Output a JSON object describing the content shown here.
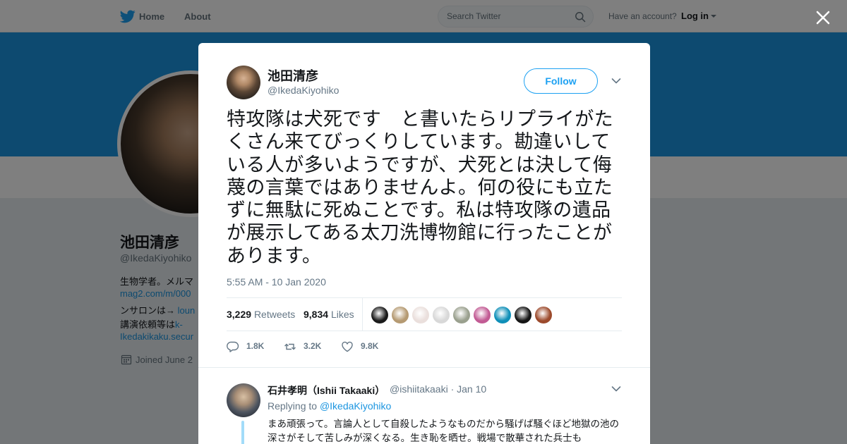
{
  "nav": {
    "home_label": "Home",
    "about_label": "About",
    "search_placeholder": "Search Twitter",
    "have_account": "Have an account?",
    "login_label": "Log in"
  },
  "profile": {
    "name": "池田清彦",
    "handle": "@IkedaKiyohiko",
    "bio_lines": [
      {
        "text": "生物学者。メルマ",
        "link": ""
      },
      {
        "text": "",
        "link": "mag2.com/m/000"
      },
      {
        "text": "ンサロンは→ ",
        "link": "loun"
      },
      {
        "text": "講演依頼等は",
        "link": "k-"
      },
      {
        "text": "",
        "link": "Ikedakikaku.secur"
      }
    ],
    "joined": "Joined June 2"
  },
  "tweet": {
    "author_name": "池田清彦",
    "author_handle": "@IkedaKiyohiko",
    "follow_label": "Follow",
    "text": "特攻隊は犬死です　と書いたらリプライがたくさん来てびっくりしています。勘違いしている人が多いようですが、犬死とは決して侮蔑の言葉ではありませんよ。何の役にも立たずに無駄に死ぬことです。私は特攻隊の遺品が展示してある太刀洗博物館に行ったことがあります。",
    "timestamp": "5:55 AM - 10 Jan 2020",
    "retweets_count": "3,229",
    "retweets_label": "Retweets",
    "likes_count": "9,834",
    "likes_label": "Likes",
    "likers": [
      {
        "name": "liker-1",
        "color": "#1a1a1a"
      },
      {
        "name": "liker-2",
        "color": "#b59a72"
      },
      {
        "name": "liker-3",
        "color": "#eadfdc"
      },
      {
        "name": "liker-4",
        "color": "#d8d8d8"
      },
      {
        "name": "liker-5",
        "color": "#9aa08e"
      },
      {
        "name": "liker-6",
        "color": "#c25b94"
      },
      {
        "name": "liker-7",
        "color": "#0f8fb8"
      },
      {
        "name": "liker-8",
        "color": "#151515"
      },
      {
        "name": "liker-9",
        "color": "#9c4a2c"
      }
    ],
    "reply_count": "1.8K",
    "retweet_count": "3.2K",
    "like_count": "9.8K"
  },
  "reply": {
    "name": "石井孝明（Ishii Takaaki）",
    "meta": "@ishiitakaaki · Jan 10",
    "replying_prefix": "Replying to ",
    "replying_to": "@IkedaKiyohiko",
    "text": "まあ頑張って。言論人として自殺したようなものだから騒げば騒ぐほど地獄の池の深さがそして苦しみが深くなる。生き恥を晒せ。戦場で散華された兵士も"
  },
  "colors": {
    "brand": "#1da1f2",
    "banner": "#1b95e0",
    "text_primary": "#14171a",
    "text_secondary": "#657786"
  }
}
